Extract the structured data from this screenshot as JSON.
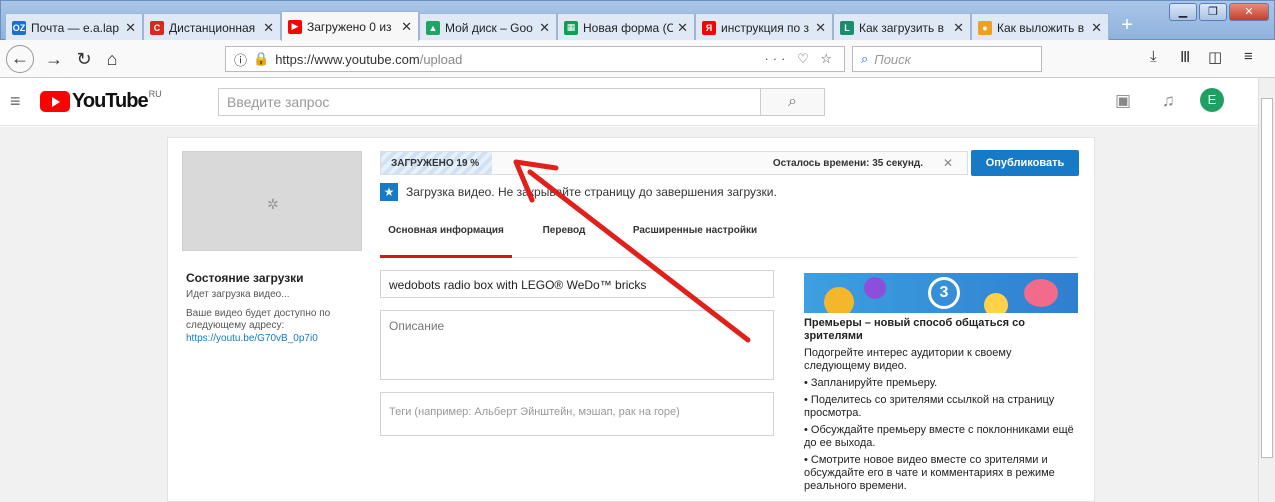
{
  "browser": {
    "tabs": [
      {
        "title": "Почта — e.a.lap",
        "icon_color": "#1a6fd0",
        "icon": "outlook-icon",
        "icon_text": "OZ"
      },
      {
        "title": "Дистанционная",
        "icon_color": "#d9291c",
        "icon": "c-icon",
        "icon_text": "C"
      },
      {
        "title": "Загружено 0 из",
        "icon_color": "#ff0000",
        "icon": "youtube-icon",
        "icon_text": "▶"
      },
      {
        "title": "Мой диск – Goo",
        "icon_color": "#1fa463",
        "icon": "drive-icon",
        "icon_text": "▲"
      },
      {
        "title": "Новая форма (С",
        "icon_color": "#0f9d58",
        "icon": "sheets-icon",
        "icon_text": "▦"
      },
      {
        "title": "инструкция по з",
        "icon_color": "#ff0000",
        "icon": "yandex-icon",
        "icon_text": "Я"
      },
      {
        "title": "Как загрузить в",
        "icon_color": "#1b8d6c",
        "icon": "l-icon",
        "icon_text": "L"
      },
      {
        "title": "Как выложить в",
        "icon_color": "#f0a020",
        "icon": "bulb-icon",
        "icon_text": "●"
      }
    ],
    "url_host": "https://www.youtube.com",
    "url_path": "/upload",
    "url_tools": "··· ♡ ☆",
    "search_placeholder": "Поиск"
  },
  "youtube": {
    "logo_word": "YouTube",
    "logo_region": "RU",
    "search_placeholder": "Введите запрос",
    "avatar_letter": "E"
  },
  "upload": {
    "status_title": "Состояние загрузки",
    "status_sub": "Идет загрузка видео...",
    "address_text": "Ваше видео будет доступно по следующему адресу:",
    "video_link": "https://youtu.be/G70vB_0p7i0",
    "progress_label": "ЗАГРУЖЕНО 19 %",
    "progress_percent": 19,
    "time_left": "Осталось времени: 35 секунд.",
    "publish_label": "Опубликовать",
    "notice": "Загрузка видео. Не закрывайте страницу до завершения загрузки.",
    "tabs": [
      "Основная информация",
      "Перевод",
      "Расширенные настройки"
    ],
    "title_value": "wedobots  radio box with LEGO® WeDo™ bricks",
    "description_placeholder": "Описание",
    "tags_placeholder": "Теги (например: Альберт Эйнштейн, мэшап, рак на горе)"
  },
  "promo": {
    "badge_number": "3",
    "title": "Премьеры – новый способ общаться со зрителями",
    "intro": "Подогрейте интерес аудитории к своему следующему видео.",
    "bullets": [
      "• Запланируйте премьеру.",
      "• Поделитесь со зрителями ссылкой на страницу просмотра.",
      "• Обсуждайте премьеру вместе с поклонниками ещё до ее выхода.",
      "• Смотрите новое видео вместе со зрителями и обсуждайте его в чате и комментариях в режиме реального времени."
    ]
  },
  "colors": {
    "accent": "#167ac6",
    "arrow": "#e0201a",
    "tab_underline": "#cc181e"
  }
}
